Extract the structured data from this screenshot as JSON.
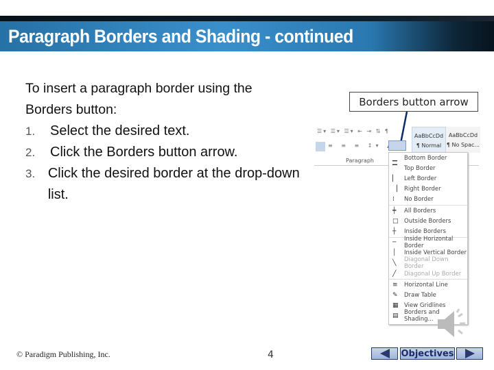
{
  "slide": {
    "title": "Paragraph Borders and Shading - continued",
    "intro": "To insert a paragraph border using the Borders button:",
    "steps": [
      {
        "n": "1.",
        "text": "Select the desired text."
      },
      {
        "n": "2.",
        "text": "Click the Borders button arrow."
      },
      {
        "n": "3.",
        "text": "Click the desired border at the drop-down list."
      }
    ],
    "callout": "Borders button arrow",
    "footer": "© Paradigm Publishing, Inc.",
    "page_number": "4",
    "nav": {
      "objectives": "Objectives"
    }
  },
  "ribbon": {
    "group_label": "Paragraph",
    "styles": [
      {
        "preview": "AaBbCcDd",
        "name": "¶ Normal"
      },
      {
        "preview": "AaBbCcDd",
        "name": "¶ No Spac..."
      }
    ]
  },
  "menu": {
    "items": [
      {
        "label": "Bottom Border",
        "icon": "bottom-border-icon",
        "enabled": true
      },
      {
        "label": "Top Border",
        "icon": "top-border-icon",
        "enabled": true
      },
      {
        "label": "Left Border",
        "icon": "left-border-icon",
        "enabled": true
      },
      {
        "label": "Right Border",
        "icon": "right-border-icon",
        "enabled": true
      },
      {
        "label": "No Border",
        "icon": "no-border-icon",
        "enabled": true
      },
      {
        "label": "All Borders",
        "icon": "all-borders-icon",
        "enabled": true
      },
      {
        "label": "Outside Borders",
        "icon": "outside-borders-icon",
        "enabled": true
      },
      {
        "label": "Inside Borders",
        "icon": "inside-borders-icon",
        "enabled": true
      },
      {
        "label": "Inside Horizontal Border",
        "icon": "inside-horizontal-border-icon",
        "enabled": true
      },
      {
        "label": "Inside Vertical Border",
        "icon": "inside-vertical-border-icon",
        "enabled": true
      },
      {
        "label": "Diagonal Down Border",
        "icon": "diagonal-down-border-icon",
        "enabled": false
      },
      {
        "label": "Diagonal Up Border",
        "icon": "diagonal-up-border-icon",
        "enabled": false
      },
      {
        "label": "Horizontal Line",
        "icon": "horizontal-line-icon",
        "enabled": true
      },
      {
        "label": "Draw Table",
        "icon": "draw-table-icon",
        "enabled": true
      },
      {
        "label": "View Gridlines",
        "icon": "view-gridlines-icon",
        "enabled": true
      },
      {
        "label": "Borders and Shading...",
        "icon": "borders-and-shading-icon",
        "enabled": true
      }
    ]
  },
  "colors": {
    "title_bar": "#3a8fcb",
    "nav_text": "#1a2c6a"
  }
}
